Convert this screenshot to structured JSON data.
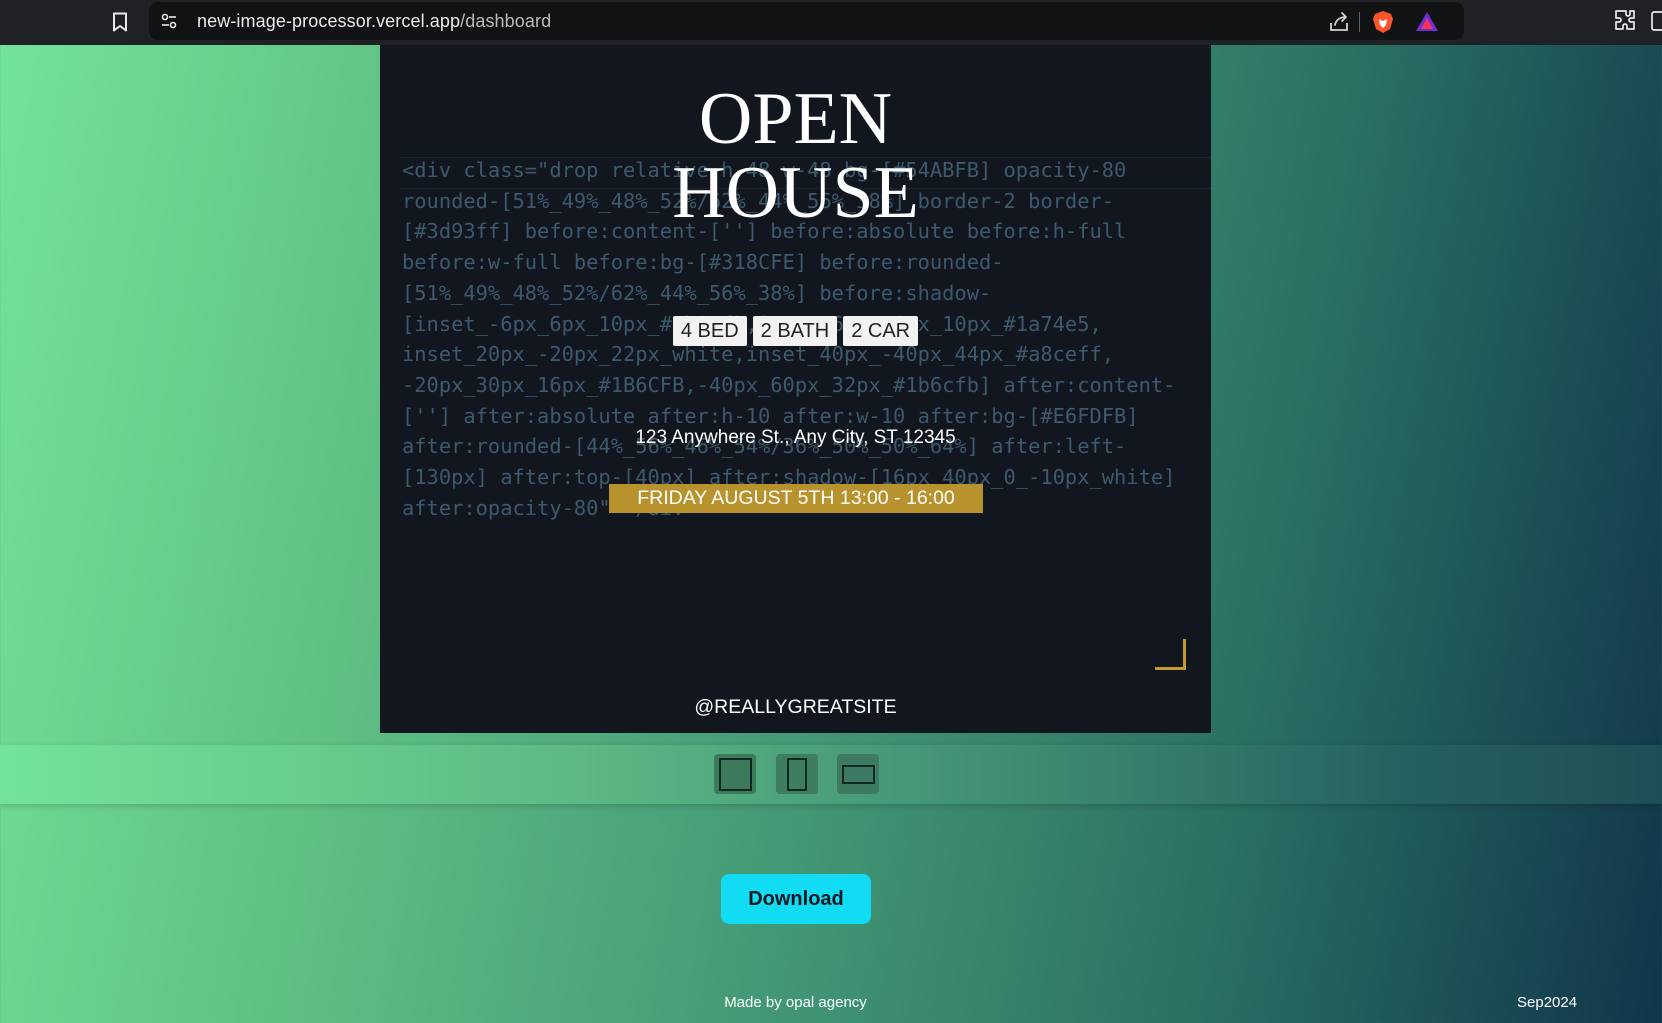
{
  "browser": {
    "url_host": "new-image-processor.vercel.app",
    "url_path": "/dashboard",
    "icons": [
      "bookmark-icon",
      "site-info-icon",
      "share-icon",
      "brave-shields-icon",
      "brave-rewards-icon",
      "extensions-icon",
      "sidebar-icon"
    ]
  },
  "poster": {
    "title_line1": "OPEN",
    "title_line2": "HOUSE",
    "features": [
      "4 BED",
      "2 BATH",
      "2 CAR"
    ],
    "address": "123 Anywhere St., Any City, ST 12345",
    "date_time": "FRIDAY AUGUST 5TH 13:00 - 16:00",
    "handle": "@REALLYGREATSITE",
    "background_code": [
      "<div class=\"drop relative h-48 w-48 bg-[#54ABFB] opacity-80",
      "rounded-[51%_49%_48%_52%/62%_44%_56%_38%] border-2 border-",
      "[#3d93ff] before:content-[''] before:absolute before:h-full",
      "before:w-full before:bg-[#318CFE] before:rounded-",
      "[51%_49%_48%_52%/62%_44%_56%_38%] before:shadow-",
      "[inset_-6px_6px_10px_#1b6cfb,inset_6px_-6px_10px_#1a74e5,",
      "inset_20px_-20px_22px_white,inset_40px_-40px_44px_#a8ceff,",
      "-20px_30px_16px_#1B6CFB,-40px_60px_32px_#1b6cfb] after:content-",
      "[''] after:absolute after:h-10 after:w-10 after:bg-[#E6FDFB]",
      "after:rounded-[44%_56%_46%_54%/36%_50%_50%_64%] after:left-",
      "[130px] after:top-[40px] after:shadow-[16px_40px_0_-10px_white]",
      "after:opacity-80\"></div>"
    ],
    "colors": {
      "background": "#11161f",
      "accent_gold": "#b8922c",
      "text": "#ffffff"
    }
  },
  "aspect_options": [
    {
      "name": "square",
      "icon": "square-icon",
      "selected": true
    },
    {
      "name": "portrait",
      "icon": "portrait-icon",
      "selected": false
    },
    {
      "name": "landscape",
      "icon": "landscape-icon",
      "selected": false
    }
  ],
  "actions": {
    "download_label": "Download",
    "download_color": "#12dcf3"
  },
  "footer": {
    "credit": "Made by opal agency",
    "date": "Sep2024"
  }
}
